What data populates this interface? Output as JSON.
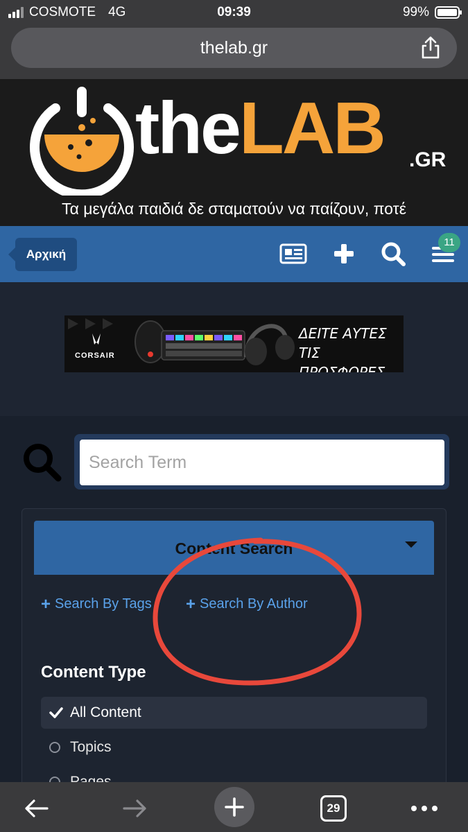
{
  "status_bar": {
    "carrier": "COSMOTE",
    "network": "4G",
    "time": "09:39",
    "battery": "99%"
  },
  "browser": {
    "url": "thelab.gr",
    "tabs_count": "29"
  },
  "site": {
    "logo_the": "the",
    "logo_lab": "LAB",
    "logo_gr": ".GR",
    "tagline": "Τα μεγάλα παιδιά δε σταματούν να παίζουν, ποτέ",
    "accent": "#f5a33a"
  },
  "nav": {
    "home_label": "Αρχική",
    "notification_count": "11",
    "icons": [
      "news-icon",
      "plus-icon",
      "search-icon",
      "menu-icon"
    ]
  },
  "ad": {
    "brand": "CORSAIR",
    "line1": "ΔΕΙΤΕ ΑΥΤΕΣ",
    "line2": "ΤΙΣ ΠΡΟΣΦΟΡΕΣ"
  },
  "search": {
    "placeholder": "Search Term",
    "scope_label": "Content Search",
    "search_by_tags": "Search By Tags",
    "search_by_author": "Search By Author",
    "content_type_title": "Content Type",
    "options": [
      "All Content",
      "Topics",
      "Pages"
    ]
  }
}
